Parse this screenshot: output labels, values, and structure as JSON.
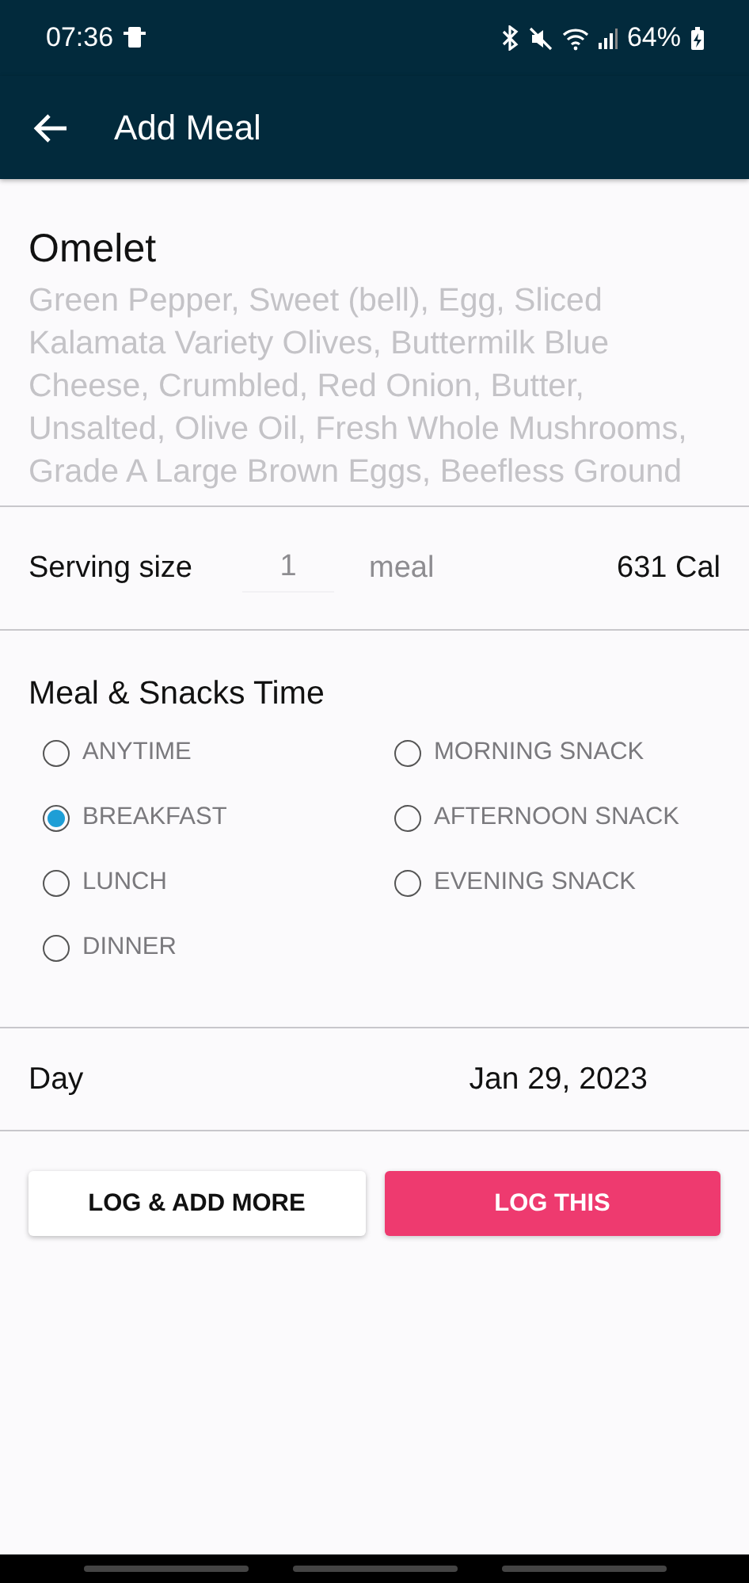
{
  "status_bar": {
    "time": "07:36",
    "battery": "64%"
  },
  "app_bar": {
    "title": "Add Meal"
  },
  "meal": {
    "name": "Omelet",
    "ingredients": "Green Pepper, Sweet (bell), Egg, Sliced Kalamata Variety Olives, Buttermilk Blue Cheese, Crumbled, Red Onion, Butter, Unsalted, Olive Oil, Fresh Whole Mushrooms, Grade A Large Brown Eggs, Beefless Ground"
  },
  "serving": {
    "label": "Serving size",
    "quantity": "1",
    "unit": "meal",
    "calories": "631 Cal"
  },
  "meal_time": {
    "heading": "Meal & Snacks Time",
    "options": [
      {
        "label": "ANYTIME",
        "selected": false
      },
      {
        "label": "BREAKFAST",
        "selected": true
      },
      {
        "label": "LUNCH",
        "selected": false
      },
      {
        "label": "DINNER",
        "selected": false
      },
      {
        "label": "MORNING SNACK",
        "selected": false
      },
      {
        "label": "AFTERNOON SNACK",
        "selected": false
      },
      {
        "label": "EVENING SNACK",
        "selected": false
      }
    ]
  },
  "day": {
    "label": "Day",
    "value": "Jan 29, 2023"
  },
  "buttons": [
    {
      "label": "LOG & ADD MORE",
      "kind": "secondary"
    },
    {
      "label": "LOG THIS",
      "kind": "primary"
    }
  ]
}
